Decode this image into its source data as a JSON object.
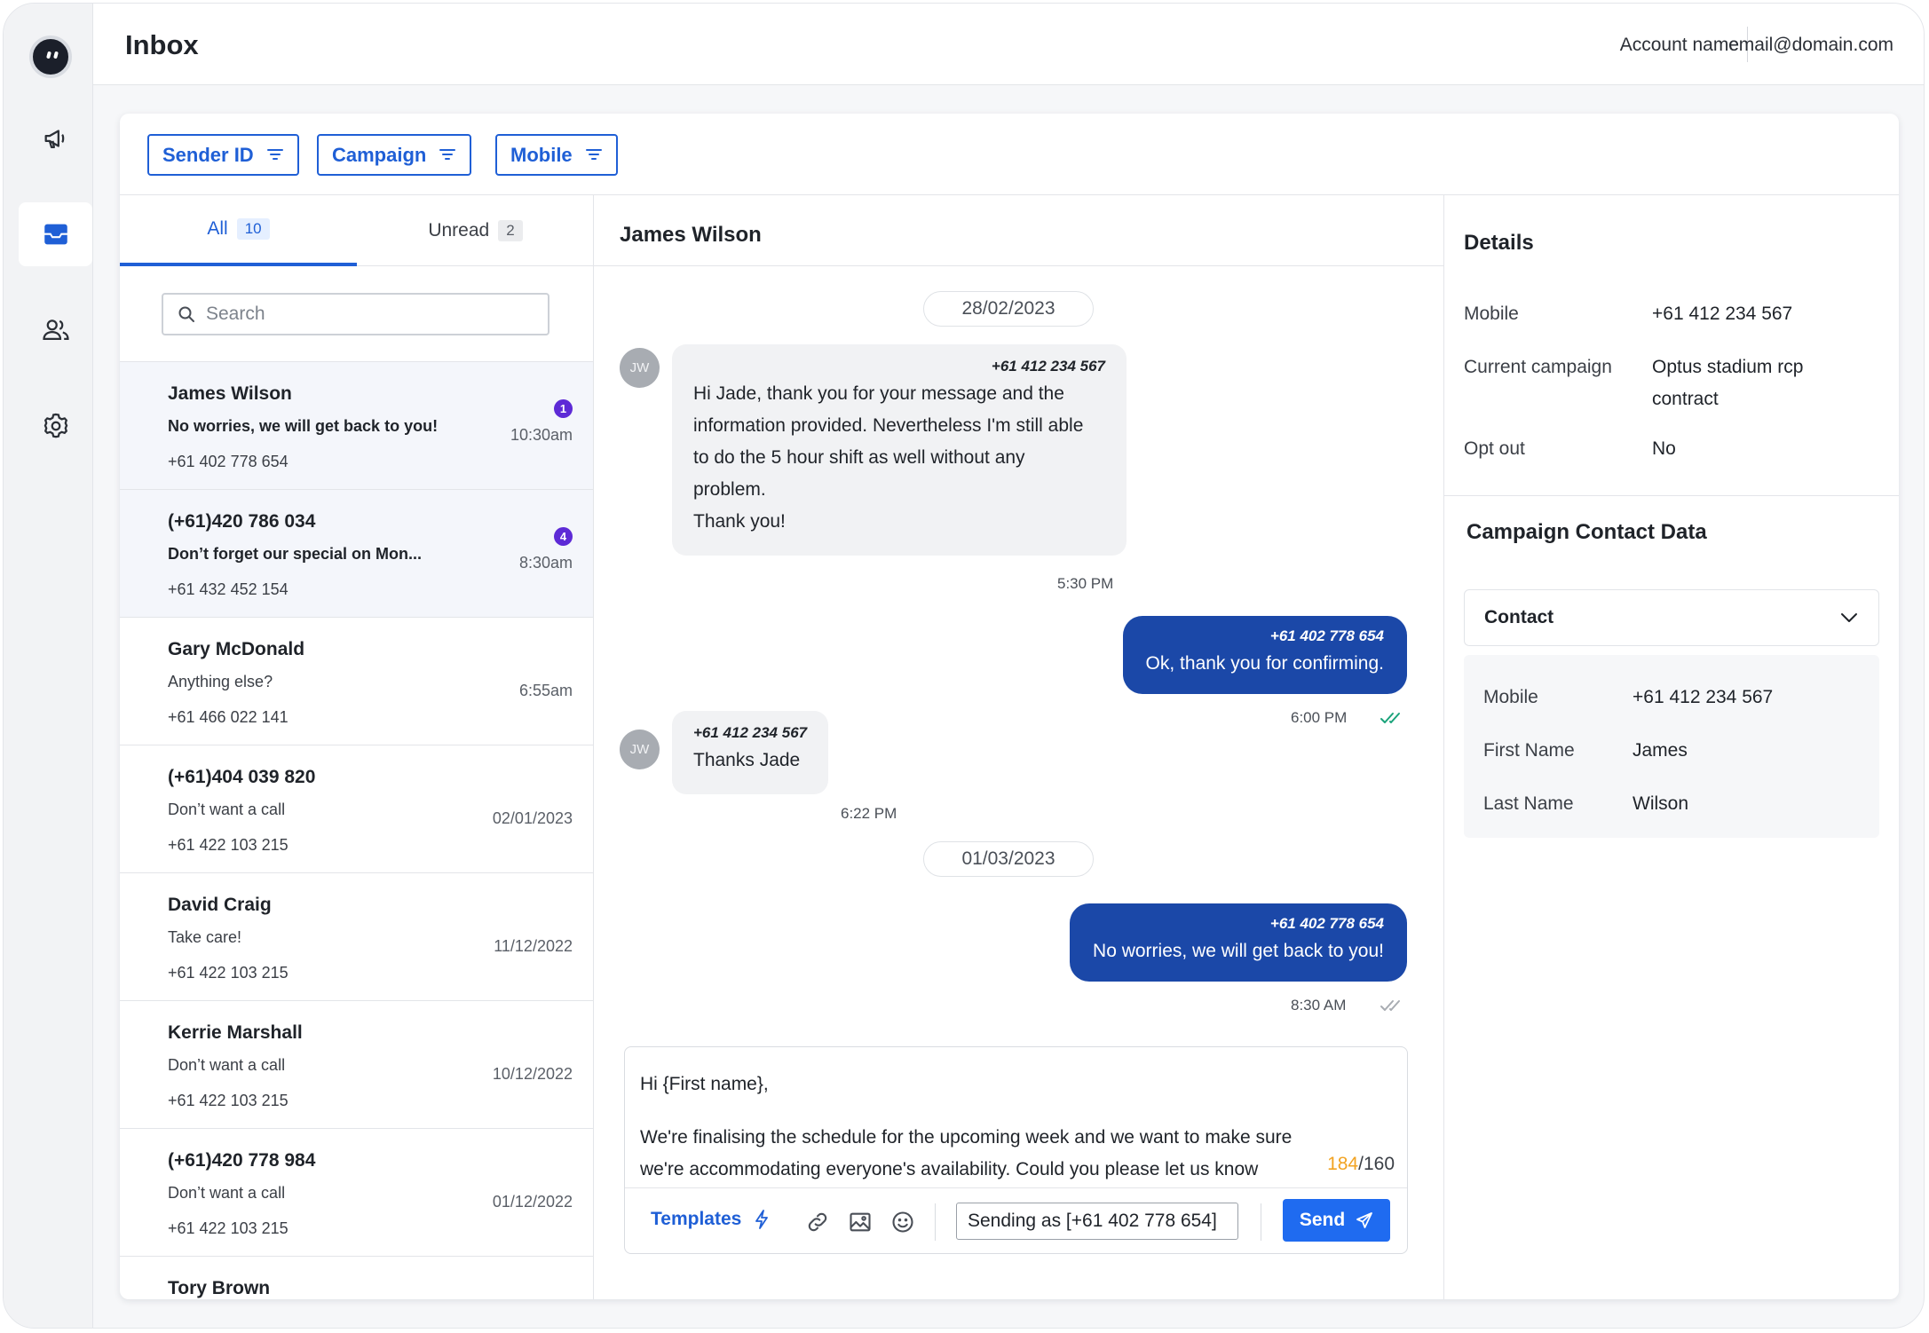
{
  "header": {
    "title": "Inbox",
    "account_name": "Account name",
    "email": "email@domain.com"
  },
  "sidebar": {
    "items": [
      {
        "icon": "megaphone-icon",
        "active": false
      },
      {
        "icon": "inbox-icon",
        "active": true
      },
      {
        "icon": "users-icon",
        "active": false
      },
      {
        "icon": "gear-icon",
        "active": false
      }
    ]
  },
  "filters": [
    {
      "label": "Sender ID",
      "icon": "filter-icon"
    },
    {
      "label": "Campaign",
      "icon": "filter-icon"
    },
    {
      "label": "Mobile",
      "icon": "filter-icon"
    }
  ],
  "tabs": {
    "all": {
      "label": "All",
      "count": "10"
    },
    "unread": {
      "label": "Unread",
      "count": "2"
    }
  },
  "search": {
    "placeholder": "Search"
  },
  "conversations": [
    {
      "name": "James Wilson",
      "preview": "No worries, we will get back to you!",
      "phone": "+61 402 778 654",
      "time": "10:30am",
      "badge": "1"
    },
    {
      "name": "(+61)420 786 034",
      "preview": "Don’t forget our special on Mon...",
      "phone": "+61 432 452 154",
      "time": "8:30am",
      "badge": "4"
    },
    {
      "name": "Gary McDonald",
      "preview": "Anything else?",
      "phone": "+61 466 022 141",
      "time": "6:55am"
    },
    {
      "name": "(+61)404 039 820",
      "preview": "Don’t want a call",
      "phone": "+61 422 103 215",
      "time": "02/01/2023"
    },
    {
      "name": "David Craig",
      "preview": "Take care!",
      "phone": "+61 422 103 215",
      "time": "11/12/2022"
    },
    {
      "name": "Kerrie Marshall",
      "preview": "Don’t want a call",
      "phone": "+61 422 103 215",
      "time": "10/12/2022"
    },
    {
      "name": "(+61)420 778 984",
      "preview": "Don’t want a call",
      "phone": "+61 422 103 215",
      "time": "01/12/2022"
    },
    {
      "name": "Tory Brown"
    }
  ],
  "chat": {
    "contact_name": "James Wilson",
    "avatar_initials": "JW",
    "date1": "28/02/2023",
    "date2": "01/03/2023",
    "messages": [
      {
        "sender": "+61 412 234 567",
        "lines": [
          "Hi Jade, thank you for your message and the",
          "information provided. Nevertheless I'm still able",
          "to do the 5 hour shift as well without any",
          "problem.",
          "Thank you!"
        ],
        "time": "5:30 PM"
      },
      {
        "sender": "+61 402 778 654",
        "text": "Ok, thank you for confirming.",
        "time": "6:00 PM",
        "status": "read"
      },
      {
        "sender": "+61 412 234 567",
        "text": "Thanks Jade",
        "time": "6:22 PM"
      },
      {
        "sender": "+61 402 778 654",
        "text": "No worries, we will get back to you!",
        "time": "8:30 AM",
        "status": "delivered"
      }
    ]
  },
  "composer": {
    "greeting": "Hi {First name},",
    "line1": "We're finalising the schedule for the upcoming week and we want to make sure",
    "line2": "we're accommodating everyone's availability. Could you please let us know",
    "char_count": "184",
    "char_limit": "/160",
    "templates_label": "Templates",
    "sending_as": "Sending as [+61 402 778 654]",
    "send_label": "Send"
  },
  "details": {
    "title": "Details",
    "rows": [
      {
        "label": "Mobile",
        "value": "+61 412 234 567"
      },
      {
        "label": "Current campaign",
        "value_line1": "Optus stadium rcp",
        "value_line2": "contract"
      },
      {
        "label": "Opt out",
        "value": "No"
      }
    ]
  },
  "campaign_contact": {
    "title": "Campaign Contact Data",
    "select_label": "Contact",
    "rows": [
      {
        "label": "Mobile",
        "value": "+61 412 234 567"
      },
      {
        "label": "First Name",
        "value": "James"
      },
      {
        "label": "Last Name",
        "value": "Wilson"
      }
    ]
  },
  "colors": {
    "accent": "#1f5fd6",
    "outgoing_bubble": "#1b48a8",
    "badge": "#5d2ad6",
    "send_button": "#1f6bf0",
    "char_over": "#f2a322"
  }
}
